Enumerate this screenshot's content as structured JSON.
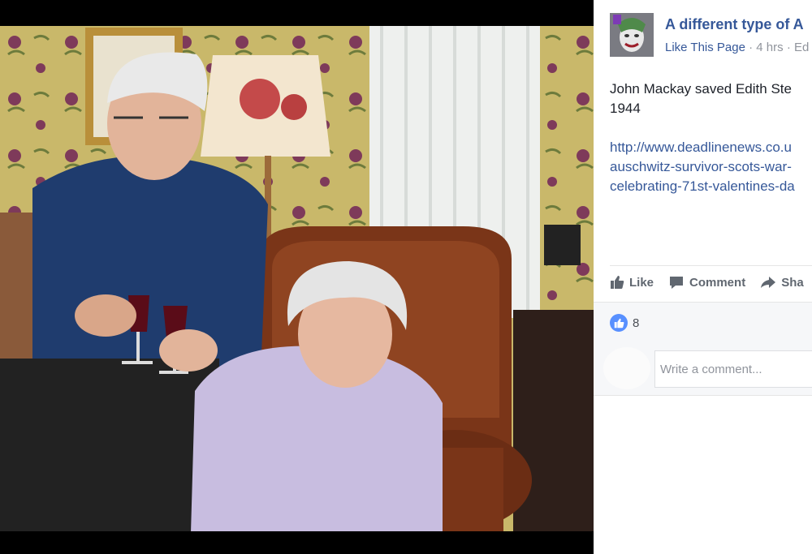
{
  "viewer": {
    "photo_alt": "Elderly couple toasting with glasses of wine"
  },
  "post": {
    "page_name": "A different type of A",
    "like_page": "Like This Page",
    "separator": " · ",
    "time": "4 hrs",
    "separator2": " · ",
    "edit": "Ed",
    "text_line1": "John Mackay saved Edith Ste",
    "text_line2": "1944",
    "link_line1": "http://www.deadlinenews.co.u",
    "link_line2": "auschwitz-survivor-scots-war-",
    "link_line3": "celebrating-71st-valentines-da"
  },
  "actions": {
    "like": "Like",
    "comment": "Comment",
    "share": "Sha"
  },
  "reactions": {
    "count": "8"
  },
  "comment": {
    "placeholder": "Write a comment..."
  },
  "colors": {
    "link_blue": "#365899",
    "like_blue": "#5890ff",
    "meta_gray": "#90949c"
  },
  "icons": [
    "like-thumb-icon",
    "comment-bubble-icon",
    "share-arrow-icon",
    "like-reaction-icon"
  ]
}
